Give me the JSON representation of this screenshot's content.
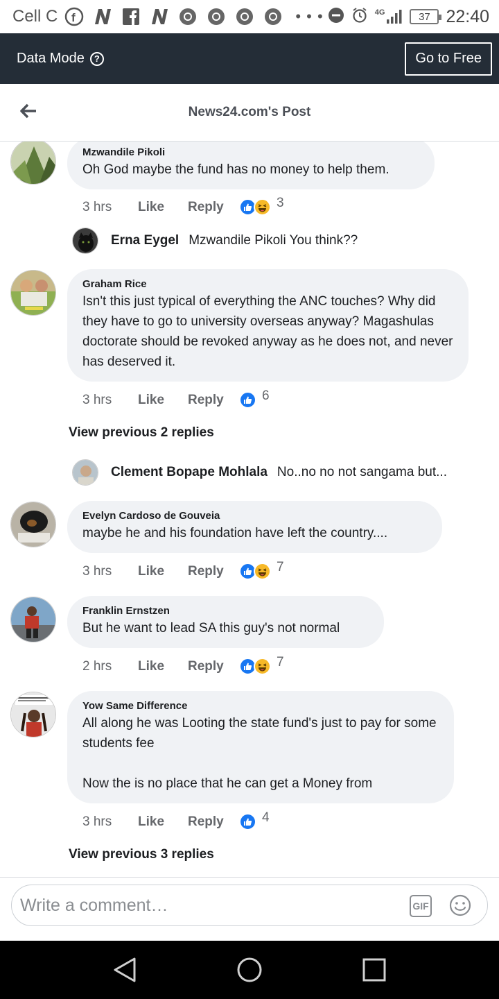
{
  "status_bar": {
    "carrier": "Cell C",
    "notification_icons": [
      "facebook-icon",
      "news-n-icon",
      "facebook-f-icon",
      "news-n-icon",
      "chrome-icon",
      "chrome-icon",
      "chrome-icon",
      "chrome-icon"
    ],
    "more": "• • •",
    "network": "4G",
    "battery": "37",
    "time": "22:40"
  },
  "data_bar": {
    "label": "Data Mode",
    "help": "?",
    "cta": "Go to Free"
  },
  "header": {
    "title": "News24.com's Post"
  },
  "comments": [
    {
      "name": "Mzwandile Pikoli",
      "text": "Oh God maybe the fund has no money to help them.",
      "time": "3 hrs",
      "like": "Like",
      "reply": "Reply",
      "reactions": [
        "like",
        "haha"
      ],
      "count": "3"
    },
    {
      "name": "Graham Rice",
      "text": "Isn't this just typical of everything the ANC touches? Why did they have to go to university overseas anyway? Magashulas doctorate should be revoked anyway as he does not, and never has deserved it.",
      "time": "3 hrs",
      "like": "Like",
      "reply": "Reply",
      "reactions": [
        "like"
      ],
      "count": "6"
    },
    {
      "name": "Evelyn Cardoso de Gouveia",
      "text": "maybe he and his foundation have left the country....",
      "time": "3 hrs",
      "like": "Like",
      "reply": "Reply",
      "reactions": [
        "like",
        "haha"
      ],
      "count": "7"
    },
    {
      "name": "Franklin Ernstzen",
      "text": "But he want to lead SA this guy's not normal",
      "time": "2 hrs",
      "like": "Like",
      "reply": "Reply",
      "reactions": [
        "like",
        "haha"
      ],
      "count": "7"
    },
    {
      "name": "Yow Same Difference",
      "text": "All along he was Looting the state fund's just to pay for some students fee\n\nNow the is no place that he can get a Money from",
      "time": "3 hrs",
      "like": "Like",
      "reply": "Reply",
      "reactions": [
        "like"
      ],
      "count": "4"
    }
  ],
  "replies": [
    {
      "name": "Erna Eygel",
      "text": "Mzwandile Pikoli You think??"
    },
    {
      "name": "Clement Bopape Mohlala",
      "text": "No..no no not sangama but..."
    }
  ],
  "view_previous": [
    "View previous 2 replies",
    "View previous 3 replies"
  ],
  "compose": {
    "placeholder": "Write a comment…",
    "gif": "GIF"
  }
}
